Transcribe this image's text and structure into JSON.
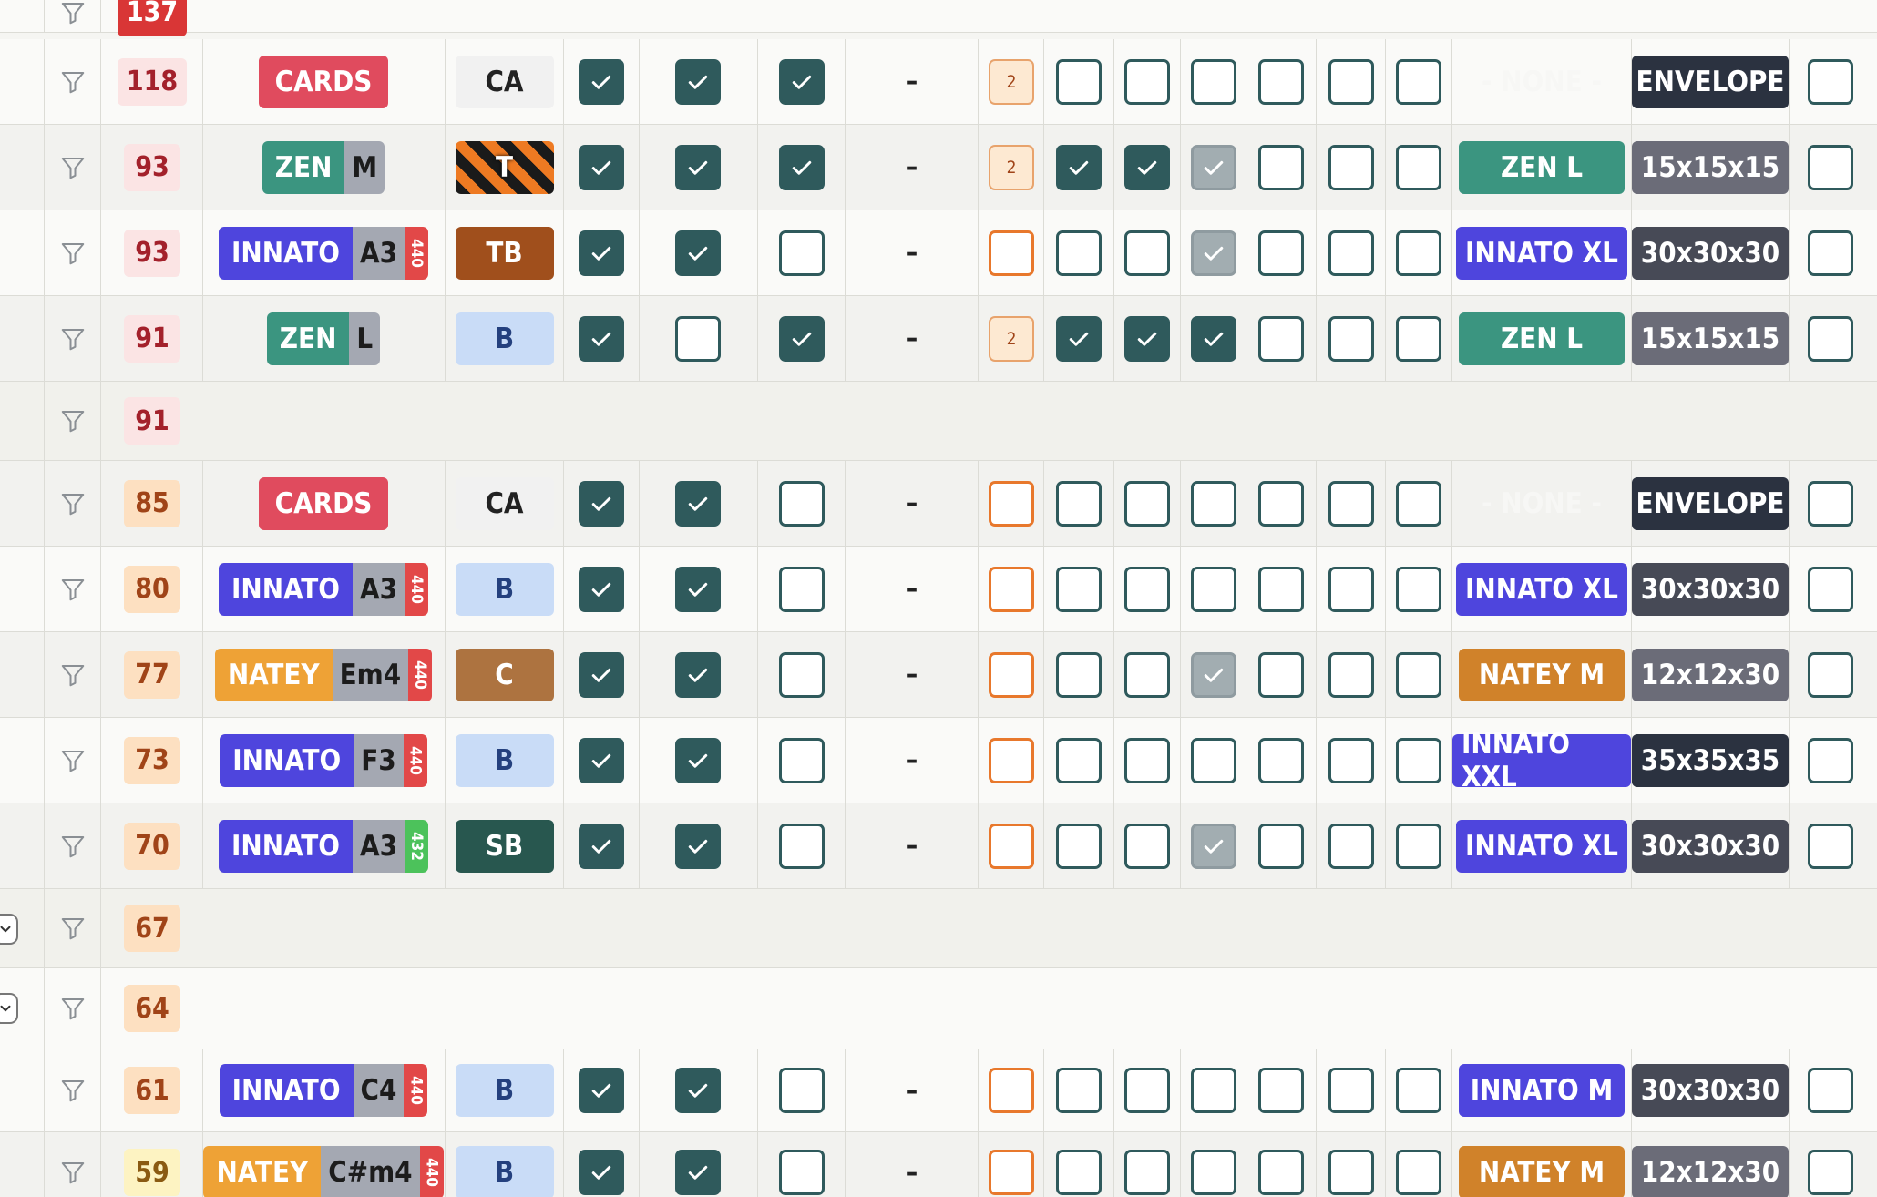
{
  "rows": [
    {
      "kind": "group",
      "score": "137",
      "score_class": "sc-darkred",
      "y": -10,
      "h": 54,
      "partial": true
    },
    {
      "kind": "full",
      "score": "118",
      "score_class": "sc-red",
      "model": {
        "type": "cards",
        "label": "CARDS"
      },
      "material": "CA",
      "c1": "on",
      "c2": "on",
      "c3": "on",
      "dash": "–",
      "qty": {
        "type": "qty",
        "value": "2"
      },
      "d": [
        "off",
        "off",
        "off",
        "off",
        "off",
        "off"
      ],
      "box": {
        "label": "- NONE -",
        "color": ""
      },
      "size": {
        "label": "ENVELOPE",
        "color": "#2b3240"
      },
      "last": "off"
    },
    {
      "kind": "full",
      "score": "93",
      "score_class": "sc-red",
      "model": {
        "type": "flute",
        "brand": "ZEN",
        "brand_color": "#3b9580",
        "note": "M",
        "tuning": ""
      },
      "material": "T",
      "c1": "on",
      "c2": "on",
      "c3": "on",
      "dash": "–",
      "qty": {
        "type": "qty",
        "value": "2"
      },
      "d": [
        "on",
        "on",
        "grey",
        "off",
        "off",
        "off"
      ],
      "box": {
        "label": "ZEN L",
        "color": "#3b9580"
      },
      "size": {
        "label": "15x15x15",
        "color": "#6b6c78"
      },
      "last": "off"
    },
    {
      "kind": "full",
      "score": "93",
      "score_class": "sc-red",
      "model": {
        "type": "flute",
        "brand": "INNATO",
        "brand_color": "#4e45dd",
        "note": "A3",
        "tuning": "440",
        "tuning_color": "#e24848"
      },
      "material": "TB",
      "c1": "on",
      "c2": "on",
      "c3": "off",
      "dash": "–",
      "qty": {
        "type": "empty"
      },
      "d": [
        "off",
        "off",
        "grey",
        "off",
        "off",
        "off"
      ],
      "box": {
        "label": "INNATO XL",
        "color": "#4e45dd"
      },
      "size": {
        "label": "30x30x30",
        "color": "#474a56"
      },
      "last": "off"
    },
    {
      "kind": "full",
      "score": "91",
      "score_class": "sc-red",
      "model": {
        "type": "flute",
        "brand": "ZEN",
        "brand_color": "#3b9580",
        "note": "L",
        "tuning": ""
      },
      "material": "B",
      "c1": "on",
      "c2": "off",
      "c3": "on",
      "dash": "–",
      "qty": {
        "type": "qty",
        "value": "2"
      },
      "d": [
        "on",
        "on",
        "on",
        "off",
        "off",
        "off"
      ],
      "box": {
        "label": "ZEN L",
        "color": "#3b9580"
      },
      "size": {
        "label": "15x15x15",
        "color": "#6b6c78"
      },
      "last": "off"
    },
    {
      "kind": "group",
      "score": "91",
      "score_class": "sc-red"
    },
    {
      "kind": "full",
      "score": "85",
      "score_class": "sc-orange",
      "model": {
        "type": "cards",
        "label": "CARDS"
      },
      "material": "CA",
      "c1": "on",
      "c2": "on",
      "c3": "off",
      "dash": "–",
      "qty": {
        "type": "empty"
      },
      "d": [
        "off",
        "off",
        "off",
        "off",
        "off",
        "off"
      ],
      "box": {
        "label": "- NONE -",
        "color": ""
      },
      "size": {
        "label": "ENVELOPE",
        "color": "#2b3240"
      },
      "last": "off"
    },
    {
      "kind": "full",
      "score": "80",
      "score_class": "sc-orange",
      "model": {
        "type": "flute",
        "brand": "INNATO",
        "brand_color": "#4e45dd",
        "note": "A3",
        "tuning": "440",
        "tuning_color": "#e24848"
      },
      "material": "B",
      "c1": "on",
      "c2": "on",
      "c3": "off",
      "dash": "–",
      "qty": {
        "type": "empty"
      },
      "d": [
        "off",
        "off",
        "off",
        "off",
        "off",
        "off"
      ],
      "box": {
        "label": "INNATO XL",
        "color": "#4e45dd"
      },
      "size": {
        "label": "30x30x30",
        "color": "#474a56"
      },
      "last": "off"
    },
    {
      "kind": "full",
      "score": "77",
      "score_class": "sc-orange",
      "model": {
        "type": "flute",
        "brand": "NATEY",
        "brand_color": "#eea236",
        "note": "Em4",
        "tuning": "440",
        "tuning_color": "#e24848"
      },
      "material": "C",
      "c1": "on",
      "c2": "on",
      "c3": "off",
      "dash": "–",
      "qty": {
        "type": "empty"
      },
      "d": [
        "off",
        "off",
        "grey",
        "off",
        "off",
        "off"
      ],
      "box": {
        "label": "NATEY M",
        "color": "#d0822a"
      },
      "size": {
        "label": "12x12x30",
        "color": "#6b6c78"
      },
      "last": "off"
    },
    {
      "kind": "full",
      "score": "73",
      "score_class": "sc-orange",
      "model": {
        "type": "flute",
        "brand": "INNATO",
        "brand_color": "#4e45dd",
        "note": "F3",
        "tuning": "440",
        "tuning_color": "#e24848"
      },
      "material": "B",
      "c1": "on",
      "c2": "on",
      "c3": "off",
      "dash": "–",
      "qty": {
        "type": "empty"
      },
      "d": [
        "off",
        "off",
        "off",
        "off",
        "off",
        "off"
      ],
      "box": {
        "label": "INNATO XXL",
        "color": "#4e45dd"
      },
      "size": {
        "label": "35x35x35",
        "color": "#2b3240"
      },
      "last": "off"
    },
    {
      "kind": "full",
      "score": "70",
      "score_class": "sc-orange",
      "model": {
        "type": "flute",
        "brand": "INNATO",
        "brand_color": "#4e45dd",
        "note": "A3",
        "tuning": "432",
        "tuning_color": "#4cc25b"
      },
      "material": "SB",
      "c1": "on",
      "c2": "on",
      "c3": "off",
      "dash": "–",
      "qty": {
        "type": "empty"
      },
      "d": [
        "off",
        "off",
        "grey",
        "off",
        "off",
        "off"
      ],
      "box": {
        "label": "INNATO XL",
        "color": "#4e45dd"
      },
      "size": {
        "label": "30x30x30",
        "color": "#474a56"
      },
      "last": "off"
    },
    {
      "kind": "group",
      "score": "67",
      "score_class": "sc-orange",
      "collapse": true
    },
    {
      "kind": "group",
      "score": "64",
      "score_class": "sc-orange",
      "collapse": true
    },
    {
      "kind": "full",
      "score": "61",
      "score_class": "sc-orange",
      "model": {
        "type": "flute",
        "brand": "INNATO",
        "brand_color": "#4e45dd",
        "note": "C4",
        "tuning": "440",
        "tuning_color": "#e24848"
      },
      "material": "B",
      "c1": "on",
      "c2": "on",
      "c3": "off",
      "dash": "–",
      "qty": {
        "type": "empty"
      },
      "d": [
        "off",
        "off",
        "off",
        "off",
        "off",
        "off"
      ],
      "box": {
        "label": "INNATO M",
        "color": "#4e45dd"
      },
      "size": {
        "label": "30x30x30",
        "color": "#474a56"
      },
      "last": "off"
    },
    {
      "kind": "full",
      "score": "59",
      "score_class": "sc-yellow",
      "model": {
        "type": "flute",
        "brand": "NATEY",
        "brand_color": "#eea236",
        "note": "C#m4",
        "tuning": "440",
        "tuning_color": "#e24848"
      },
      "material": "B",
      "c1": "on",
      "c2": "on",
      "c3": "off",
      "dash": "–",
      "qty": {
        "type": "empty"
      },
      "d": [
        "off",
        "off",
        "off",
        "off",
        "off",
        "off"
      ],
      "box": {
        "label": "NATEY M",
        "color": "#d0822a"
      },
      "size": {
        "label": "12x12x30",
        "color": "#6b6c78"
      },
      "last": "off"
    }
  ],
  "colors": {
    "accent": "#2f5a5c",
    "checked": "#2f5a5c",
    "grey_check": "#a2adb1",
    "orange_border": "#e8782c"
  }
}
